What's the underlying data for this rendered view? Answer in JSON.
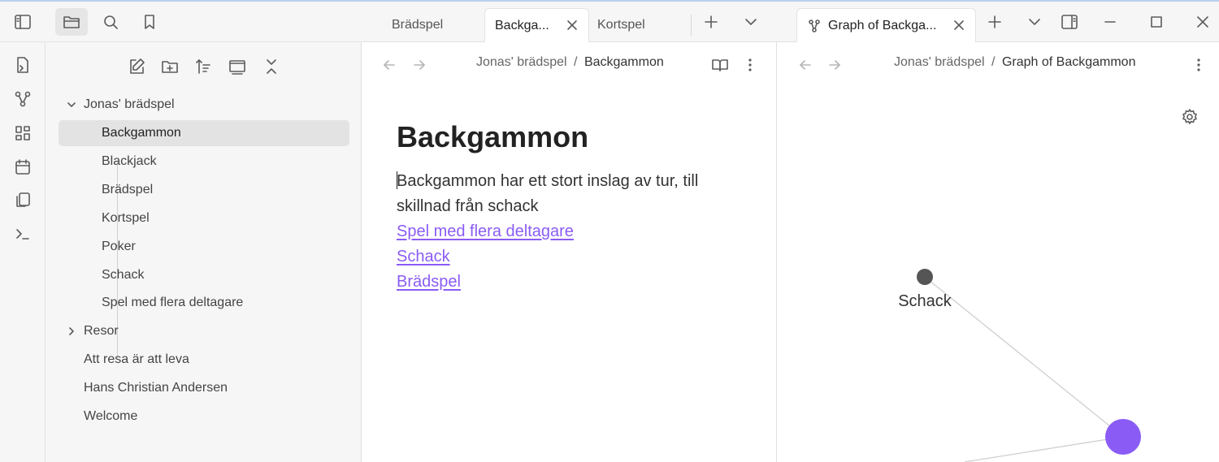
{
  "tabs_left": [
    {
      "label": "Brädspel",
      "active": false
    },
    {
      "label": "Backga...",
      "active": true
    },
    {
      "label": "Kortspel",
      "active": false
    }
  ],
  "tabs_right": [
    {
      "label": "Graph of Backga...",
      "active": true
    }
  ],
  "sidebar": {
    "tree": [
      {
        "label": "Jonas' brädspel",
        "type": "folder",
        "expanded": true
      },
      {
        "label": "Backgammon",
        "type": "file",
        "selected": true
      },
      {
        "label": "Blackjack",
        "type": "file"
      },
      {
        "label": "Brädspel",
        "type": "file"
      },
      {
        "label": "Kortspel",
        "type": "file"
      },
      {
        "label": "Poker",
        "type": "file"
      },
      {
        "label": "Schack",
        "type": "file"
      },
      {
        "label": "Spel med flera deltagare",
        "type": "file"
      },
      {
        "label": "Resor",
        "type": "folder",
        "expanded": false
      },
      {
        "label": "Att resa är att leva",
        "type": "file"
      },
      {
        "label": "Hans Christian Andersen",
        "type": "file"
      },
      {
        "label": "Welcome",
        "type": "file"
      }
    ]
  },
  "editor": {
    "breadcrumb_parent": "Jonas' brädspel",
    "breadcrumb_sep": "/",
    "breadcrumb_current": "Backgammon",
    "title": "Backgammon",
    "paragraph": "Backgammon har ett stort inslag av tur, till skillnad från schack",
    "links": [
      "Spel med flera deltagare",
      "Schack",
      "Brädspel"
    ]
  },
  "graph_view": {
    "breadcrumb_parent": "Jonas' brädspel",
    "breadcrumb_sep": "/",
    "breadcrumb_current": "Graph of Backgammon",
    "nodes": [
      {
        "label": "Schack",
        "color": "#555555"
      },
      {
        "label": "",
        "color": "#8a5cf5",
        "current": true
      }
    ]
  },
  "colors": {
    "accent": "#8a5cf5",
    "sidebar_bg": "#f6f6f6",
    "node_grey": "#555555"
  }
}
